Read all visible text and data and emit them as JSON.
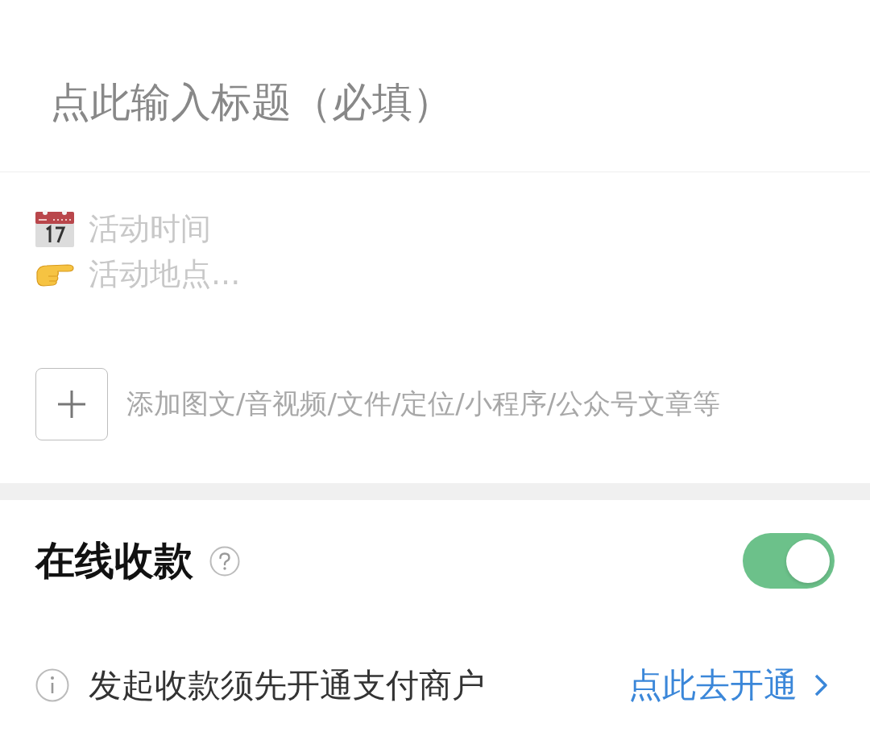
{
  "title_field": {
    "placeholder": "点此输入标题（必填）"
  },
  "description": {
    "lines": [
      {
        "kind": "time",
        "placeholder": "活动时间"
      },
      {
        "kind": "place",
        "placeholder": "活动地点..."
      }
    ]
  },
  "attachments": {
    "hint": "添加图文/音视频/文件/定位/小程序/公众号文章等"
  },
  "payment": {
    "title": "在线收款",
    "on": true,
    "notice": "发起收款须先开通支付商户",
    "link": "点此去开通"
  }
}
